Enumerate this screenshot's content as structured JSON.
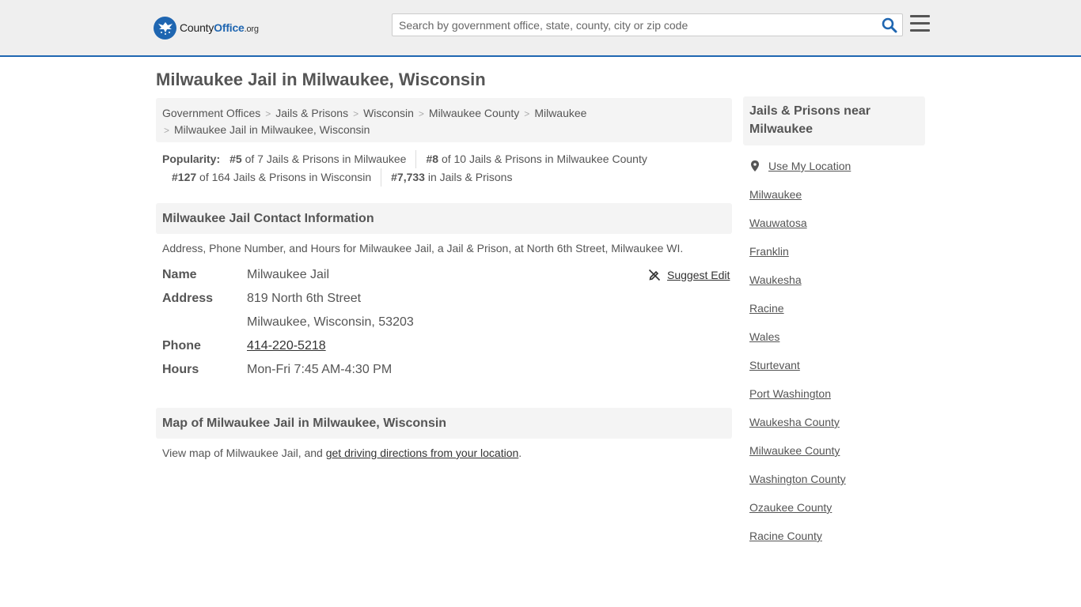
{
  "header": {
    "logo": {
      "part1": "County",
      "part2": "Office",
      "tld": ".org"
    },
    "search_placeholder": "Search by government office, state, county, city or zip code"
  },
  "page_title": "Milwaukee Jail in Milwaukee, Wisconsin",
  "breadcrumb": {
    "items": [
      "Government Offices",
      "Jails & Prisons",
      "Wisconsin",
      "Milwaukee County",
      "Milwaukee"
    ],
    "current": "Milwaukee Jail in Milwaukee, Wisconsin"
  },
  "popularity": {
    "label": "Popularity:",
    "items": [
      {
        "rank": "#5",
        "text": "of 7 Jails & Prisons in Milwaukee"
      },
      {
        "rank": "#8",
        "text": "of 10 Jails & Prisons in Milwaukee County"
      },
      {
        "rank": "#127",
        "text": "of 164 Jails & Prisons in Wisconsin"
      },
      {
        "rank": "#7,733",
        "text": "in Jails & Prisons"
      }
    ]
  },
  "contact": {
    "heading": "Milwaukee Jail Contact Information",
    "description": "Address, Phone Number, and Hours for Milwaukee Jail, a Jail & Prison, at North 6th Street, Milwaukee WI.",
    "suggest_edit": "Suggest Edit",
    "name_label": "Name",
    "name": "Milwaukee Jail",
    "address_label": "Address",
    "address_line1": "819 North 6th Street",
    "address_line2": "Milwaukee, Wisconsin, 53203",
    "phone_label": "Phone",
    "phone": "414-220-5218",
    "hours_label": "Hours",
    "hours": "Mon-Fri 7:45 AM-4:30 PM"
  },
  "map": {
    "heading": "Map of Milwaukee Jail in Milwaukee, Wisconsin",
    "text_before": "View map of Milwaukee Jail, and ",
    "link": "get driving directions from your location",
    "text_after": "."
  },
  "sidebar": {
    "heading": "Jails & Prisons near Milwaukee",
    "use_location": "Use My Location",
    "links": [
      "Milwaukee",
      "Wauwatosa",
      "Franklin",
      "Waukesha",
      "Racine",
      "Wales",
      "Sturtevant",
      "Port Washington",
      "Waukesha County",
      "Milwaukee County",
      "Washington County",
      "Ozaukee County",
      "Racine County"
    ]
  },
  "colors": {
    "brand": "#1f66b1",
    "panel_bg": "#f4f4f4",
    "header_bg": "#efefef",
    "text": "#555555"
  }
}
